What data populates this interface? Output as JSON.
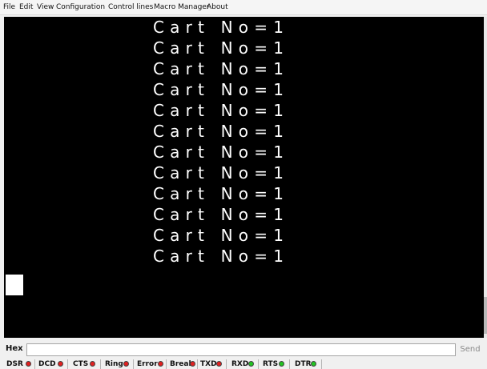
{
  "menu": [
    "File",
    "Edit",
    "View",
    "Configuration",
    "Control lines",
    "Macro Manager",
    "About"
  ],
  "terminal": {
    "lines": [
      "Cart No=1",
      "Cart No=1",
      "Cart No=1",
      "Cart No=1",
      "Cart No=1",
      "Cart No=1",
      "Cart No=1",
      "Cart No=1",
      "Cart No=1",
      "Cart No=1",
      "Cart No=1",
      "Cart No=1"
    ]
  },
  "hex": {
    "label": "Hex",
    "value": "",
    "send_label": "Send"
  },
  "status": [
    {
      "label": "DSR",
      "state": "off"
    },
    {
      "label": "DCD",
      "state": "off"
    },
    {
      "label": "CTS",
      "state": "off"
    },
    {
      "label": "Ring",
      "state": "off"
    },
    {
      "label": "Error",
      "state": "off"
    },
    {
      "label": "Break",
      "state": "off"
    },
    {
      "label": "TXD",
      "state": "off"
    },
    {
      "label": "RXD",
      "state": "on"
    },
    {
      "label": "RTS",
      "state": "on"
    },
    {
      "label": "DTR",
      "state": "on"
    }
  ],
  "colors": {
    "led_off": "#e02020",
    "led_on": "#22c322",
    "terminal_bg": "#000000",
    "terminal_fg": "#ffffff"
  }
}
